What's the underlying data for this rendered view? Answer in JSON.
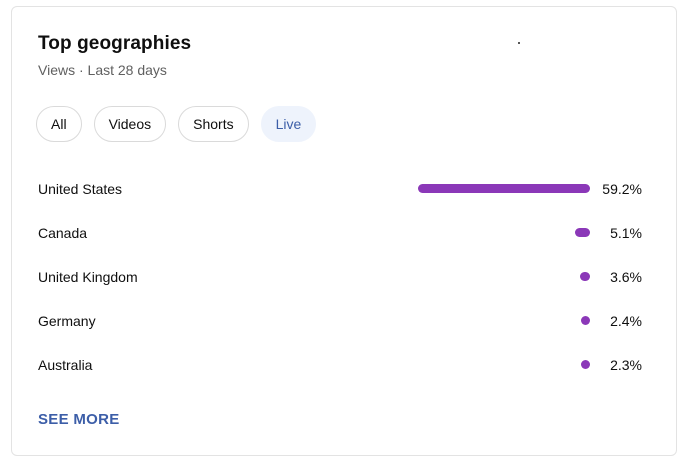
{
  "header": {
    "title": "Top geographies",
    "subtitle": "Views · Last 28 days"
  },
  "filters": {
    "chips": [
      {
        "label": "All",
        "selected": false
      },
      {
        "label": "Videos",
        "selected": false
      },
      {
        "label": "Shorts",
        "selected": false
      },
      {
        "label": "Live",
        "selected": true
      }
    ]
  },
  "chart_data": {
    "type": "bar",
    "categories": [
      "United States",
      "Canada",
      "United Kingdom",
      "Germany",
      "Australia"
    ],
    "values": [
      59.2,
      5.1,
      3.6,
      2.4,
      2.3
    ],
    "value_labels": [
      "59.2%",
      "5.1%",
      "3.6%",
      "2.4%",
      "2.3%"
    ],
    "title": "",
    "xlabel": "",
    "ylabel": "",
    "orientation": "horizontal",
    "bar_color": "#8b38b8"
  },
  "footer": {
    "see_more_label": "SEE MORE"
  },
  "colors": {
    "accent": "#3c5ea8",
    "bar": "#8b38b8",
    "selected_chip_bg": "#eef3fc"
  }
}
